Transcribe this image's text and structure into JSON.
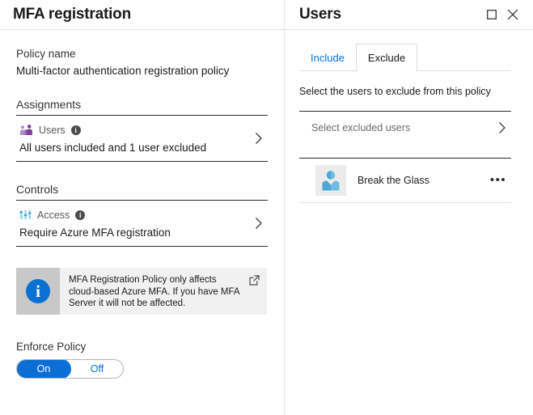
{
  "left": {
    "title": "MFA registration",
    "policy_name_label": "Policy name",
    "policy_name_value": "Multi-factor authentication registration policy",
    "assignments": {
      "section_title": "Assignments",
      "row_title": "Users",
      "row_subtitle": "All users included and 1 user excluded",
      "icon": "users-group-icon",
      "info_glyph": "i",
      "chevron": "chevron-right-icon",
      "icon_color": "#8b52ab"
    },
    "controls": {
      "section_title": "Controls",
      "row_title": "Access",
      "row_subtitle": "Require Azure MFA registration",
      "icon": "access-sliders-icon",
      "info_glyph": "i",
      "chevron": "chevron-right-icon",
      "icon_color": "#7ec8e3"
    },
    "info_banner": {
      "icon": "info-circle-icon",
      "icon_glyph": "i",
      "icon_bg": "#0a70d2",
      "text": "MFA Registration Policy only affects cloud-based Azure MFA. If you have MFA Server it will not be affected.",
      "external_link_icon": "external-link-icon"
    },
    "enforce": {
      "label": "Enforce Policy",
      "on_label": "On",
      "off_label": "Off",
      "selected": "On",
      "accent": "#0a6ed6"
    }
  },
  "right": {
    "title": "Users",
    "window_buttons": [
      {
        "name": "maximize-button",
        "icon": "square-icon"
      },
      {
        "name": "close-button",
        "icon": "close-x-icon"
      }
    ],
    "tabs": [
      {
        "label": "Include",
        "active": false
      },
      {
        "label": "Exclude",
        "active": true
      }
    ],
    "description": "Select the users to exclude from this policy",
    "select_row": {
      "label": "Select excluded users",
      "chevron": "chevron-right-icon"
    },
    "users": [
      {
        "name": "Break the Glass",
        "avatar": "person-avatar-icon",
        "menu": "more-options-icon",
        "menu_glyph": "•••"
      }
    ]
  }
}
